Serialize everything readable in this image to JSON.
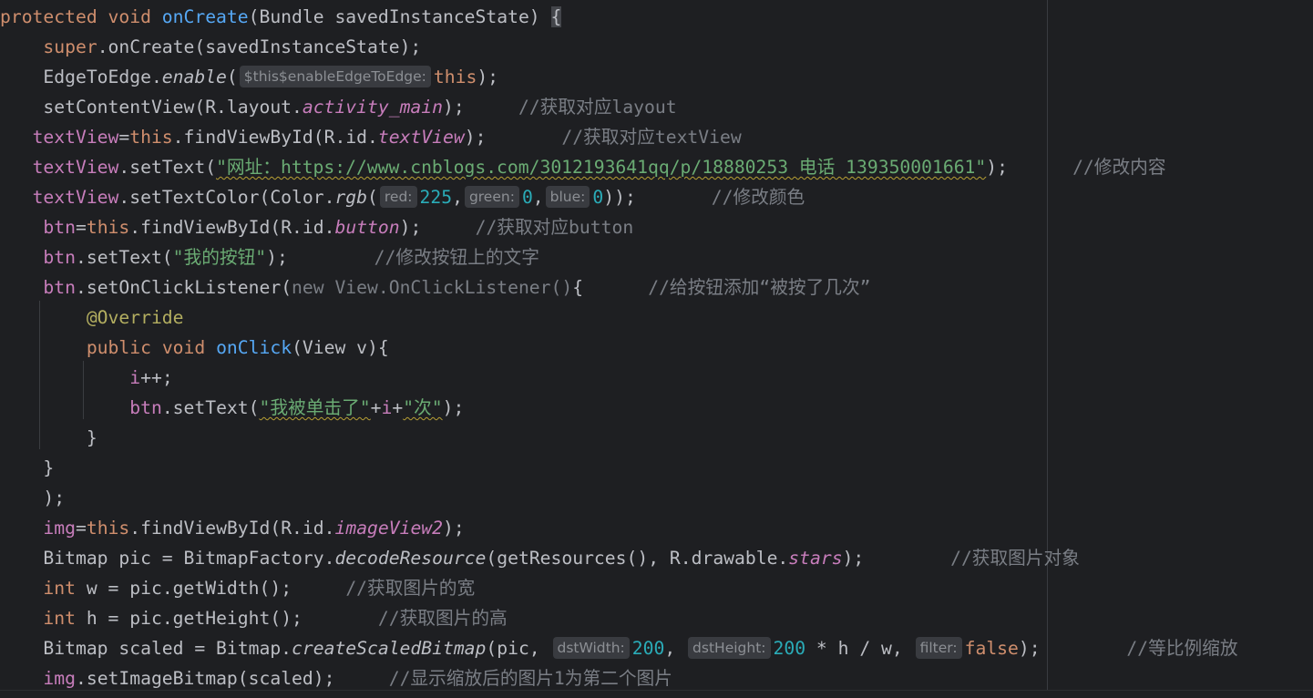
{
  "editor": {
    "lines": [
      {
        "parts": [
          {
            "t": "protected ",
            "c": "kw"
          },
          {
            "t": "void ",
            "c": "kw"
          },
          {
            "t": "onCreate",
            "c": "fn"
          },
          {
            "t": "(Bundle savedInstanceState) "
          },
          {
            "t": "{",
            "c": "brace-hl"
          }
        ]
      },
      {
        "parts": [
          {
            "t": "    "
          },
          {
            "t": "super",
            "c": "kw"
          },
          {
            "t": ".onCreate(savedInstanceState);"
          }
        ]
      },
      {
        "parts": [
          {
            "t": "    EdgeToEdge."
          },
          {
            "t": "enable",
            "c": "st"
          },
          {
            "t": "("
          },
          {
            "hint": "$this$enableEdgeToEdge:"
          },
          {
            "t": "this",
            "c": "kw"
          },
          {
            "t": ");"
          }
        ]
      },
      {
        "parts": [
          {
            "t": "    setContentView(R.layout."
          },
          {
            "t": "activity_main",
            "c": "fld"
          },
          {
            "t": ");     "
          },
          {
            "t": "//获取对应layout",
            "c": "cm"
          }
        ]
      },
      {
        "parts": [
          {
            "t": "   "
          },
          {
            "t": "textView",
            "c": "fldp"
          },
          {
            "t": "="
          },
          {
            "t": "this",
            "c": "kw"
          },
          {
            "t": ".findViewById(R.id."
          },
          {
            "t": "textView",
            "c": "fld"
          },
          {
            "t": ");       "
          },
          {
            "t": "//获取对应textView",
            "c": "cm"
          }
        ]
      },
      {
        "parts": [
          {
            "t": "   "
          },
          {
            "t": "textView",
            "c": "fldp"
          },
          {
            "t": ".setText("
          },
          {
            "t": "\"网址：https://www.cnblogs.com/3012193641qq/p/18880253 电话 139350001661\"",
            "c": "str warn"
          },
          {
            "t": ");      "
          },
          {
            "t": "//修改内容",
            "c": "cm"
          }
        ]
      },
      {
        "parts": [
          {
            "t": "   "
          },
          {
            "t": "textView",
            "c": "fldp"
          },
          {
            "t": ".setTextColor(Color."
          },
          {
            "t": "rgb",
            "c": "st"
          },
          {
            "t": "("
          },
          {
            "hint": "red:"
          },
          {
            "t": "225",
            "c": "num"
          },
          {
            "t": ","
          },
          {
            "hint": "green:"
          },
          {
            "t": "0",
            "c": "num"
          },
          {
            "t": ","
          },
          {
            "hint": "blue:"
          },
          {
            "t": "0",
            "c": "num"
          },
          {
            "t": "));       "
          },
          {
            "t": "//修改颜色",
            "c": "cm"
          }
        ]
      },
      {
        "parts": [
          {
            "t": "    "
          },
          {
            "t": "btn",
            "c": "fldp"
          },
          {
            "t": "="
          },
          {
            "t": "this",
            "c": "kw"
          },
          {
            "t": ".findViewById(R.id."
          },
          {
            "t": "button",
            "c": "fld"
          },
          {
            "t": ");     "
          },
          {
            "t": "//获取对应button",
            "c": "cm"
          }
        ]
      },
      {
        "parts": [
          {
            "t": "    "
          },
          {
            "t": "btn",
            "c": "fldp"
          },
          {
            "t": ".setText("
          },
          {
            "t": "\"我的按钮\"",
            "c": "str"
          },
          {
            "t": ");        "
          },
          {
            "t": "//修改按钮上的文字",
            "c": "cm"
          }
        ]
      },
      {
        "parts": [
          {
            "t": "    "
          },
          {
            "t": "btn",
            "c": "fldp"
          },
          {
            "t": ".setOnClickListener("
          },
          {
            "t": "new View.OnClickListener()",
            "c": "dim"
          },
          {
            "t": "{      "
          },
          {
            "t": "//给按钮添加“被按了几次”",
            "c": "cm"
          }
        ]
      },
      {
        "parts": [
          {
            "t": "        "
          },
          {
            "t": "@Override",
            "c": "ann"
          }
        ]
      },
      {
        "parts": [
          {
            "t": "        "
          },
          {
            "t": "public ",
            "c": "kw"
          },
          {
            "t": "void ",
            "c": "kw"
          },
          {
            "t": "onClick",
            "c": "fn"
          },
          {
            "t": "(View v){"
          }
        ]
      },
      {
        "parts": [
          {
            "t": "            "
          },
          {
            "t": "i",
            "c": "fldp"
          },
          {
            "t": "++;"
          }
        ]
      },
      {
        "parts": [
          {
            "t": "            "
          },
          {
            "t": "btn",
            "c": "fldp"
          },
          {
            "t": ".setText("
          },
          {
            "t": "\"我被单击了\"",
            "c": "str warn"
          },
          {
            "t": "+"
          },
          {
            "t": "i",
            "c": "fldp"
          },
          {
            "t": "+"
          },
          {
            "t": "\"次\"",
            "c": "str warn"
          },
          {
            "t": ");"
          }
        ]
      },
      {
        "parts": [
          {
            "t": "        }"
          }
        ]
      },
      {
        "parts": [
          {
            "t": "    }"
          }
        ]
      },
      {
        "parts": [
          {
            "t": "    );"
          }
        ]
      },
      {
        "parts": [
          {
            "t": "    "
          },
          {
            "t": "img",
            "c": "fldp"
          },
          {
            "t": "="
          },
          {
            "t": "this",
            "c": "kw"
          },
          {
            "t": ".findViewById(R.id."
          },
          {
            "t": "imageView2",
            "c": "fld"
          },
          {
            "t": ");"
          }
        ]
      },
      {
        "parts": [
          {
            "t": "    Bitmap pic = BitmapFactory."
          },
          {
            "t": "decodeResource",
            "c": "st"
          },
          {
            "t": "(getResources(), R.drawable."
          },
          {
            "t": "stars",
            "c": "fld"
          },
          {
            "t": ");        "
          },
          {
            "t": "//获取图片对象",
            "c": "cm"
          }
        ]
      },
      {
        "parts": [
          {
            "t": "    "
          },
          {
            "t": "int ",
            "c": "kw"
          },
          {
            "t": "w = pic.getWidth();     "
          },
          {
            "t": "//获取图片的宽",
            "c": "cm"
          }
        ]
      },
      {
        "parts": [
          {
            "t": "    "
          },
          {
            "t": "int ",
            "c": "kw"
          },
          {
            "t": "h = pic.getHeight();       "
          },
          {
            "t": "//获取图片的高",
            "c": "cm"
          }
        ]
      },
      {
        "parts": [
          {
            "t": "    Bitmap scaled = Bitmap."
          },
          {
            "t": "createScaledBitmap",
            "c": "st"
          },
          {
            "t": "(pic, "
          },
          {
            "hint": "dstWidth:"
          },
          {
            "t": "200",
            "c": "num"
          },
          {
            "t": ", "
          },
          {
            "hint": "dstHeight:"
          },
          {
            "t": "200",
            "c": "num"
          },
          {
            "t": " * h / w, "
          },
          {
            "hint": "filter:"
          },
          {
            "t": "false",
            "c": "kw"
          },
          {
            "t": ");        "
          },
          {
            "t": "//等比例缩放",
            "c": "cm"
          }
        ]
      },
      {
        "parts": [
          {
            "t": "    "
          },
          {
            "t": "img",
            "c": "fldp"
          },
          {
            "t": ".setImageBitmap(scaled);     "
          },
          {
            "t": "//显示缩放后的图片1为第二个图片",
            "c": "cm"
          }
        ]
      }
    ]
  }
}
